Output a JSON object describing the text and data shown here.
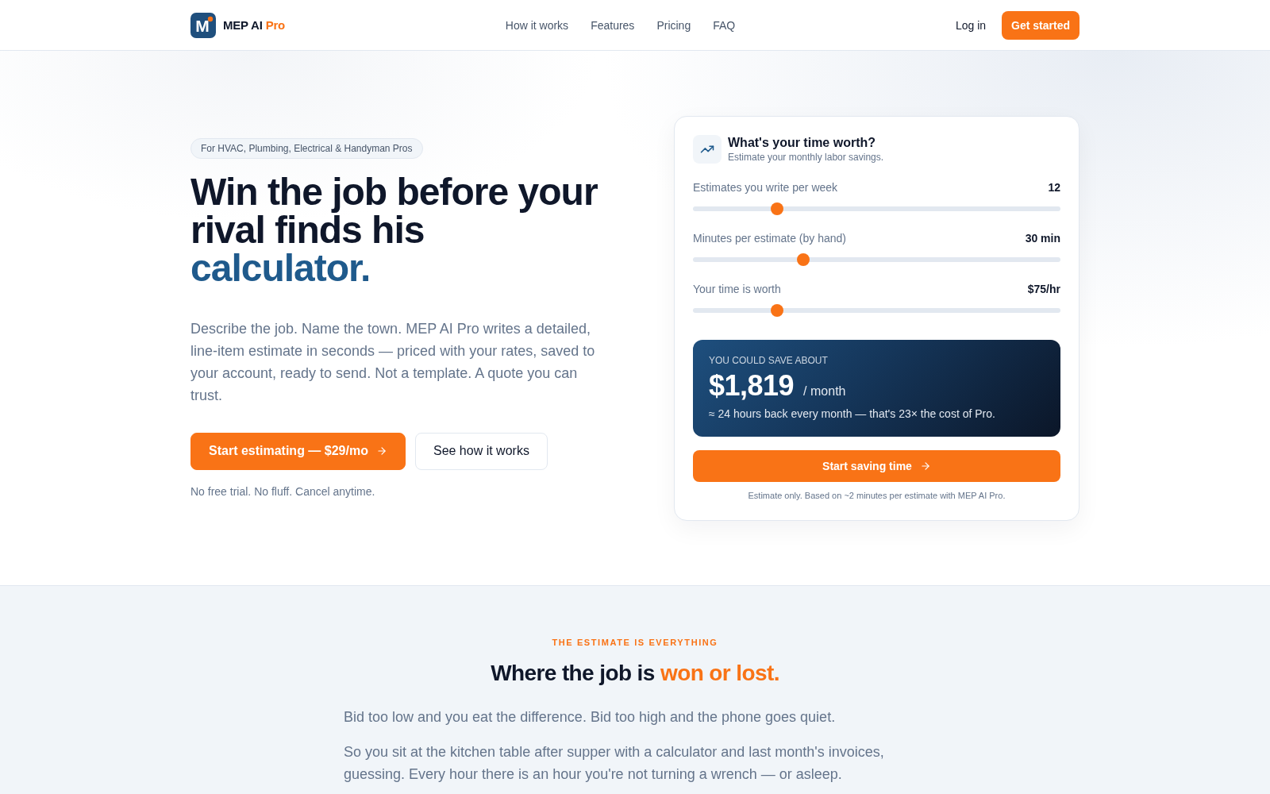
{
  "header": {
    "brand": {
      "mark": "M",
      "name": "MEP AI",
      "accent": "Pro"
    },
    "nav": [
      "How it works",
      "Features",
      "Pricing",
      "FAQ"
    ],
    "login": "Log in",
    "cta": "Get started"
  },
  "hero": {
    "badge": "For HVAC, Plumbing, Electrical & Handyman Pros",
    "headline": {
      "text": "Win the job before your rival finds his",
      "accent": "calculator."
    },
    "description": "Describe the job. Name the town. MEP AI Pro writes a detailed, line-item estimate in seconds — priced with your rates, saved to your account, ready to send. Not a template. A quote you can trust.",
    "buttons": [
      {
        "kind": "primary",
        "label": "Start estimating — $29/mo"
      },
      {
        "kind": "secondary",
        "label": "See how it works"
      }
    ],
    "note": "No free trial. No fluff. Cancel anytime."
  },
  "calculator": {
    "title": "What's your time worth?",
    "subtitle": "Estimate your monthly labor savings.",
    "sliders": [
      {
        "label": "Estimates you write per week",
        "reading": "12",
        "level": 0.23
      },
      {
        "label": "Minutes per estimate (by hand)",
        "reading": "30 min",
        "level": 0.3
      },
      {
        "label": "Your time is worth",
        "reading": "$75/hr",
        "level": 0.23
      }
    ],
    "result": {
      "eyebrow": "YOU COULD SAVE ABOUT",
      "amount": "$1,819",
      "unit": "/ month",
      "detail": "≈ 24 hours back every month — that's 23× the cost of Pro."
    },
    "button": "Start saving time",
    "footnote": "Estimate only. Based on ~2 minutes per estimate with MEP AI Pro."
  },
  "section": {
    "eyebrow": "THE ESTIMATE IS EVERYTHING",
    "heading": {
      "text": "Where the job is",
      "accent": "won or lost."
    },
    "paragraphs": [
      "Bid too low and you eat the difference. Bid too high and the phone goes quiet.",
      "So you sit at the kitchen table after supper with a calculator and last month's invoices, guessing. Every hour there is an hour you're not turning a wrench — or asleep."
    ]
  }
}
